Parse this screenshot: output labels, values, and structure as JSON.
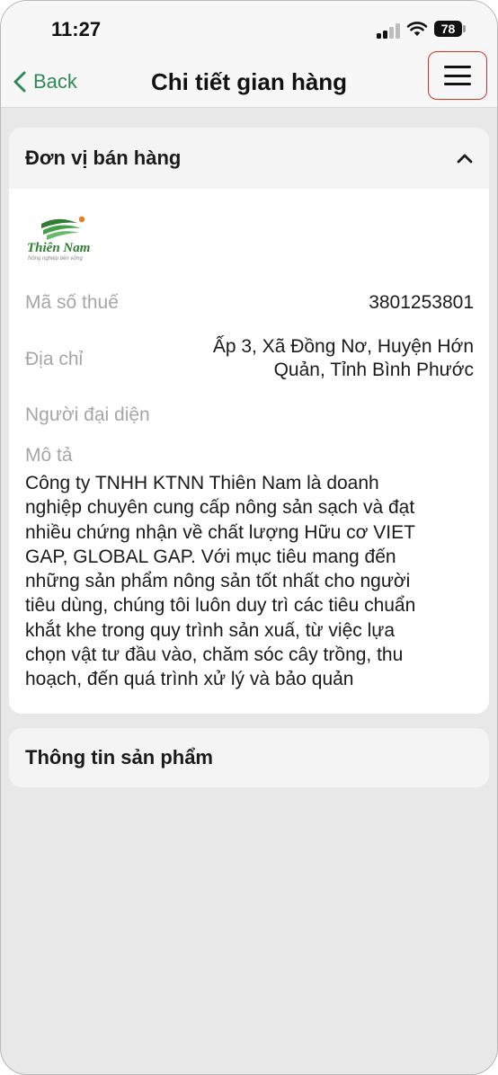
{
  "status_bar": {
    "time": "11:27",
    "battery": "78"
  },
  "nav": {
    "back_label": "Back",
    "title": "Chi tiết gian hàng"
  },
  "seller_section": {
    "title": "Đơn vị bán hàng",
    "logo": {
      "name": "Thiên Nam",
      "tagline": "Nông nghiệp bền vững"
    },
    "tax_code_label": "Mã số thuế",
    "tax_code_value": "3801253801",
    "address_label": "Địa chỉ",
    "address_line1": "Ấp 3, Xã Đồng Nơ, Huyện Hớn",
    "address_line2": "Quản, Tỉnh Bình Phước",
    "representative_label": "Người đại diện",
    "description_label": "Mô tả",
    "description_lines": [
      "Công ty TNHH KTNN Thiên Nam là doanh",
      "nghiệp chuyên cung cấp nông sản sạch và đạt",
      "nhiều chứng nhận về chất lượng Hữu cơ VIET",
      "GAP, GLOBAL GAP. Với mục tiêu mang đến",
      "những sản phẩm nông sản tốt nhất cho người",
      "tiêu dùng, chúng tôi luôn duy trì các tiêu chuẩn",
      "khắt khe trong quy trình sản xuấ, từ việc lựa",
      "chọn vật tư đầu vào, chăm sóc cây trồng, thu",
      "hoạch, đến quá trình xử lý và bảo quản"
    ]
  },
  "product_section": {
    "title": "Thông tin sản phẩm"
  },
  "colors": {
    "accent": "#2e8b57",
    "highlight": "#d9302b",
    "background": "#e8e8e8"
  },
  "icons": {
    "back": "chevron-left-icon",
    "menu": "hamburger-menu-icon",
    "collapse": "chevron-up-icon"
  }
}
